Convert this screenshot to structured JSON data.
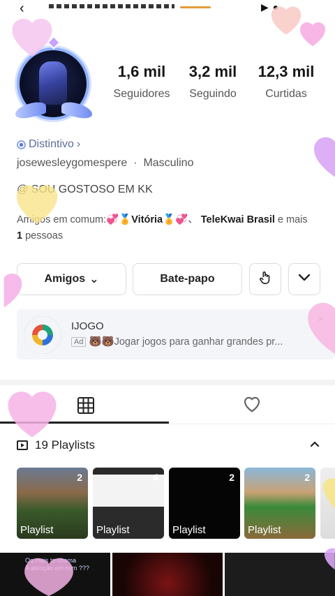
{
  "top": {
    "back_icon": "back-arrow-icon"
  },
  "profile": {
    "stats": [
      {
        "value": "1,6 mil",
        "label": "Seguidores"
      },
      {
        "value": "3,2 mil",
        "label": "Seguindo"
      },
      {
        "value": "12,3 mil",
        "label": "Curtidas"
      }
    ],
    "badge_label": "Distintivo",
    "username": "josewesleygomespere",
    "gender": "Masculino",
    "bio": "@ SOU GOSTOSO EM KK",
    "mutual_prefix": "Amigos em comum:",
    "mutual_name_1": "Vitória",
    "mutual_sep": "、",
    "mutual_name_2": "TeleKwai Brasil",
    "mutual_suffix_1": "e mais",
    "mutual_count": "1",
    "mutual_suffix_2": "pessoas"
  },
  "actions": {
    "friends_label": "Amigos",
    "chat_label": "Bate-papo"
  },
  "ad": {
    "title": "IJOGO",
    "tag": "Ad",
    "text": "🐻🐻Jogar jogos para ganhar grandes pr...",
    "close": "×"
  },
  "playlists": {
    "header": "19 Playlists",
    "cards": [
      {
        "count": "2",
        "caption": "Playlist"
      },
      {
        "count": "4",
        "caption": "Playlist"
      },
      {
        "count": "2",
        "caption": "Playlist"
      },
      {
        "count": "2",
        "caption": "Playlist"
      }
    ]
  },
  "feed": {
    "thumb_1_text": "Oq mais te chama\nA atenção em mim ???"
  },
  "colors": {
    "accent_blue": "#8fb2ff",
    "heart_pink": "#f6b3e6",
    "heart_yellow": "#f7e48a",
    "heart_purple": "#d9a6f5"
  }
}
